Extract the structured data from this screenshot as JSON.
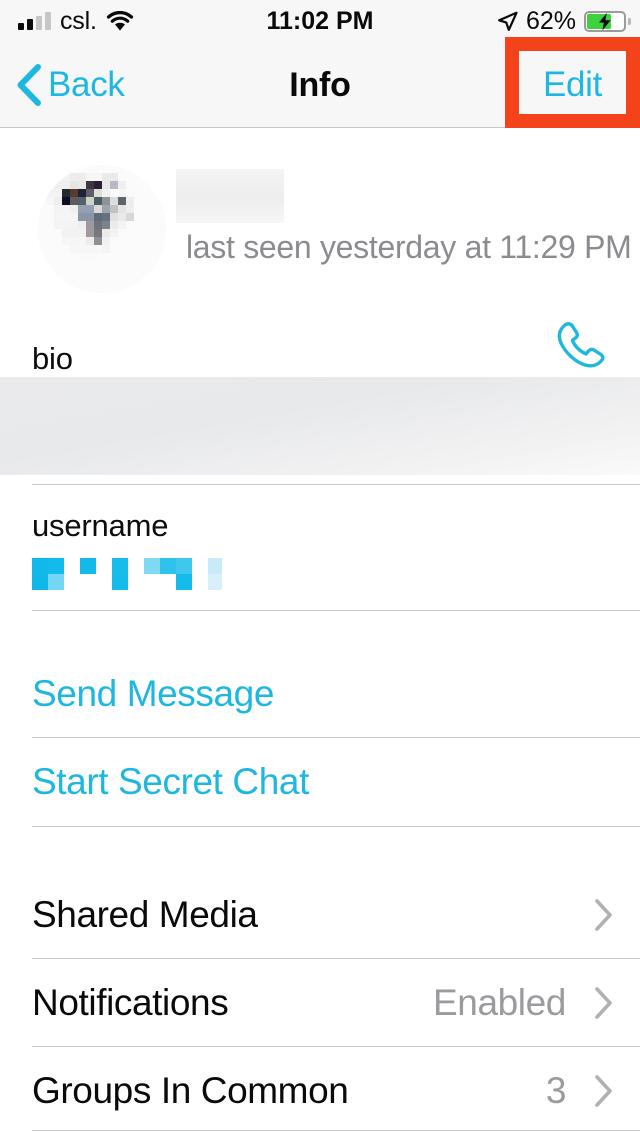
{
  "status_bar": {
    "carrier": "csl.",
    "signal_bars_filled": 2,
    "signal_bars_total": 4,
    "wifi_icon": "wifi-icon",
    "time": "11:02 PM",
    "location_icon": "location-arrow-icon",
    "battery_percent": "62%",
    "battery_level": 62,
    "battery_charging": true,
    "battery_fill_color": "#3bd23b"
  },
  "nav_bar": {
    "back_label": "Back",
    "back_icon": "chevron-left-icon",
    "title": "Info",
    "edit_label": "Edit",
    "accent_color": "#1eb7e0",
    "highlight_color": "#f4431a"
  },
  "contact": {
    "avatar": "contact-avatar-redacted",
    "name": "",
    "name_redacted": true,
    "status": "last seen yesterday at 11:29 PM",
    "call_icon": "phone-icon"
  },
  "fields": {
    "bio_label": "bio",
    "bio_value": "",
    "bio_redacted": true,
    "username_label": "username",
    "username_value": "",
    "username_redacted": true
  },
  "actions": [
    {
      "label": "Send Message",
      "name": "send-message-link"
    },
    {
      "label": "Start Secret Chat",
      "name": "start-secret-chat-link"
    }
  ],
  "list_rows": [
    {
      "label": "Shared Media",
      "value": "",
      "chevron": true
    },
    {
      "label": "Notifications",
      "value": "Enabled",
      "chevron": true
    },
    {
      "label": "Groups In Common",
      "value": "3",
      "chevron": true
    }
  ]
}
